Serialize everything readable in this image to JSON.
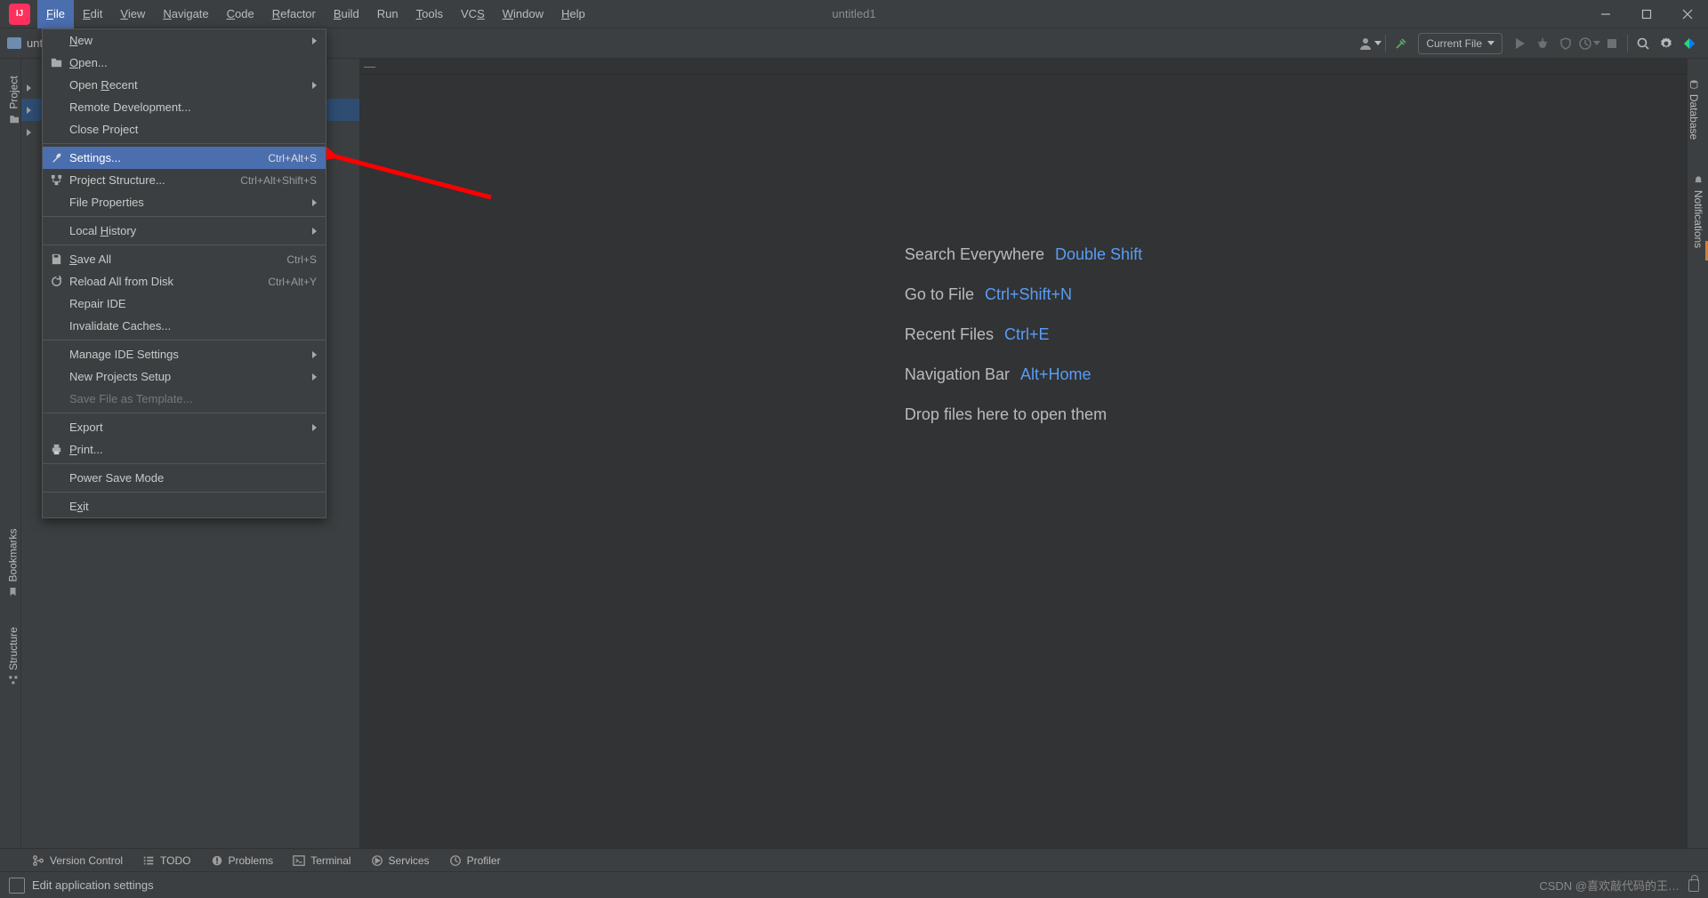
{
  "title": "untitled1",
  "menubar": [
    "File",
    "Edit",
    "View",
    "Navigate",
    "Code",
    "Refactor",
    "Build",
    "Run",
    "Tools",
    "VCS",
    "Window",
    "Help"
  ],
  "menubar_mn": [
    "F",
    "E",
    "V",
    "N",
    "C",
    "R",
    "B",
    "R",
    "T",
    "V",
    "W",
    "H"
  ],
  "breadcrumb": "untitled1",
  "run_config": "Current File",
  "dropdown": {
    "groups": [
      [
        {
          "label": "New",
          "icon": "",
          "mn": "N",
          "sub": true
        },
        {
          "label": "Open...",
          "icon": "folder",
          "mn": "O"
        },
        {
          "label": "Open Recent",
          "icon": "",
          "mn": "R",
          "sub": true
        },
        {
          "label": "Remote Development...",
          "icon": ""
        },
        {
          "label": "Close Project",
          "icon": ""
        }
      ],
      [
        {
          "label": "Settings...",
          "icon": "wrench",
          "shortcut": "Ctrl+Alt+S",
          "hl": true
        },
        {
          "label": "Project Structure...",
          "icon": "structure",
          "shortcut": "Ctrl+Alt+Shift+S"
        },
        {
          "label": "File Properties",
          "icon": "",
          "sub": true
        }
      ],
      [
        {
          "label": "Local History",
          "icon": "",
          "mn": "H",
          "sub": true
        }
      ],
      [
        {
          "label": "Save All",
          "icon": "save",
          "mn": "S",
          "shortcut": "Ctrl+S"
        },
        {
          "label": "Reload All from Disk",
          "icon": "reload",
          "shortcut": "Ctrl+Alt+Y"
        },
        {
          "label": "Repair IDE",
          "icon": ""
        },
        {
          "label": "Invalidate Caches...",
          "icon": ""
        }
      ],
      [
        {
          "label": "Manage IDE Settings",
          "icon": "",
          "sub": true
        },
        {
          "label": "New Projects Setup",
          "icon": "",
          "sub": true
        },
        {
          "label": "Save File as Template...",
          "icon": "",
          "disabled": true
        }
      ],
      [
        {
          "label": "Export",
          "icon": "",
          "sub": true
        },
        {
          "label": "Print...",
          "icon": "print",
          "mn": "P"
        }
      ],
      [
        {
          "label": "Power Save Mode",
          "icon": ""
        }
      ],
      [
        {
          "label": "Exit",
          "icon": "",
          "mn": "x"
        }
      ]
    ]
  },
  "welcome": [
    {
      "label": "Search Everywhere",
      "key": "Double Shift"
    },
    {
      "label": "Go to File",
      "key": "Ctrl+Shift+N"
    },
    {
      "label": "Recent Files",
      "key": "Ctrl+E"
    },
    {
      "label": "Navigation Bar",
      "key": "Alt+Home"
    }
  ],
  "welcome_drop": "Drop files here to open them",
  "left_tabs": {
    "project": "Project",
    "bookmarks": "Bookmarks",
    "structure": "Structure"
  },
  "right_tabs": {
    "database": "Database",
    "notifications": "Notifications"
  },
  "bottom_tools": [
    {
      "icon": "branch",
      "label": "Version Control"
    },
    {
      "icon": "list",
      "label": "TODO"
    },
    {
      "icon": "error",
      "label": "Problems"
    },
    {
      "icon": "terminal",
      "label": "Terminal"
    },
    {
      "icon": "play",
      "label": "Services"
    },
    {
      "icon": "clock",
      "label": "Profiler"
    }
  ],
  "status_text": "Edit application settings",
  "watermark": "CSDN @喜欢敲代码的王…"
}
